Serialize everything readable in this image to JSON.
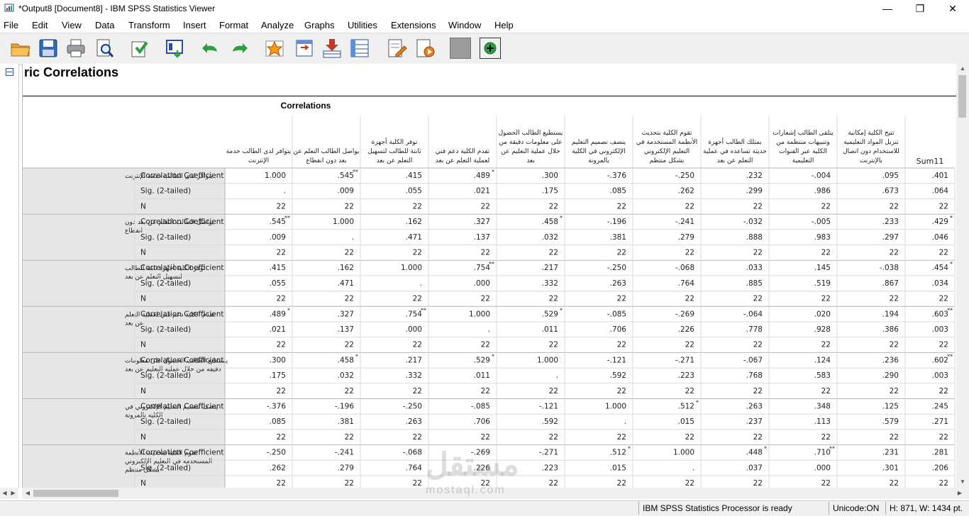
{
  "window": {
    "title": "*Output8 [Document8] - IBM SPSS Statistics Viewer",
    "controls": {
      "minimize": "—",
      "maximize": "❐",
      "close": "✕"
    }
  },
  "menu": [
    "File",
    "Edit",
    "View",
    "Data",
    "Transform",
    "Insert",
    "Format",
    "Analyze",
    "Graphs",
    "Utilities",
    "Extensions",
    "Window",
    "Help"
  ],
  "toolbar": [
    "open-icon",
    "save-icon",
    "print-icon",
    "print-preview-icon",
    "export-icon",
    "recall-dialog-icon",
    "undo-icon",
    "redo-icon",
    "goto-case-icon",
    "goto-variable-icon",
    "insert-cases-icon",
    "variables-icon",
    "designate-window-icon",
    "run-script-icon",
    "select-output-icon",
    "create-edit-icon"
  ],
  "output": {
    "heading": "ric Correlations",
    "table_title": "Correlations",
    "columns": [
      "يتوافر لدى الطالب خدمة الإنترنت",
      "يواصل الطالب التعلم عن بعد دون انقطاع",
      "توفر الكلية أجهزة ثابتة للطالب لتسهيل التعلم عن بعد",
      "تقدم الكلية دعم فني لعملية التعلم عن بعد",
      "يستطيع الطالب الحصول على معلومات دقيقة من خلال عملية التعليم عن بعد",
      "يتصف تصميم التعليم الإلكتروني في الكلية بالمرونة",
      "تقوم الكلية بتحديث الأنظمة المستخدمة في التعليم الإلكتروني بشكل منتظم",
      "يمتلك الطالب أجهزة حديثة تساعده في عملية التعلم عن بعد",
      "يتلقى الطالب إشعارات وتنبيهات منتظمة من الكلية عبر القنوات التعليمية",
      "تتيح الكلية إمكانية تنزيل المواد التعليمية للاستخدام دون اتصال بالإنترنت",
      "Sum11"
    ],
    "stat_labels": [
      "Correlation Coefficient",
      "Sig. (2-tailed)",
      "N"
    ],
    "rows": [
      {
        "label": "يتوافر لدى الطالب خدمة الإنترنت",
        "corr": [
          "1.000",
          ".545**",
          ".415",
          ".489*",
          ".300",
          "-.376",
          "-.250",
          ".232",
          "-.004",
          ".095",
          ".401"
        ],
        "sig": [
          ".",
          ".009",
          ".055",
          ".021",
          ".175",
          ".085",
          ".262",
          ".299",
          ".986",
          ".673",
          ".064"
        ],
        "n": [
          "22",
          "22",
          "22",
          "22",
          "22",
          "22",
          "22",
          "22",
          "22",
          "22",
          "22"
        ]
      },
      {
        "label": "يواصل الطالب التعلم عن بعد دون انقطاع",
        "corr": [
          ".545**",
          "1.000",
          ".162",
          ".327",
          ".458*",
          "-.196",
          "-.241",
          "-.032",
          "-.005",
          ".233",
          ".429*"
        ],
        "sig": [
          ".009",
          ".",
          ".471",
          ".137",
          ".032",
          ".381",
          ".279",
          ".888",
          ".983",
          ".297",
          ".046"
        ],
        "n": [
          "22",
          "22",
          "22",
          "22",
          "22",
          "22",
          "22",
          "22",
          "22",
          "22",
          "22"
        ]
      },
      {
        "label": "توفر الكلية أجهزة ثابتة للطالب لتسهيل التعلم عن بعد",
        "corr": [
          ".415",
          ".162",
          "1.000",
          ".754**",
          ".217",
          "-.250",
          "-.068",
          ".033",
          ".145",
          "-.038",
          ".454*"
        ],
        "sig": [
          ".055",
          ".471",
          ".",
          ".000",
          ".332",
          ".263",
          ".764",
          ".885",
          ".519",
          ".867",
          ".034"
        ],
        "n": [
          "22",
          "22",
          "22",
          "22",
          "22",
          "22",
          "22",
          "22",
          "22",
          "22",
          "22"
        ]
      },
      {
        "label": "تقدم الكلية دعم فني لعملية التعلم عن بعد",
        "corr": [
          ".489*",
          ".327",
          ".754**",
          "1.000",
          ".529*",
          "-.085",
          "-.269",
          "-.064",
          ".020",
          ".194",
          ".603**"
        ],
        "sig": [
          ".021",
          ".137",
          ".000",
          ".",
          ".011",
          ".706",
          ".226",
          ".778",
          ".928",
          ".386",
          ".003"
        ],
        "n": [
          "22",
          "22",
          "22",
          "22",
          "22",
          "22",
          "22",
          "22",
          "22",
          "22",
          "22"
        ]
      },
      {
        "label": "يستطيع الطالب الحصول على معلومات دقيقة من خلال عملية التعليم عن بعد",
        "corr": [
          ".300",
          ".458*",
          ".217",
          ".529*",
          "1.000",
          "-.121",
          "-.271",
          "-.067",
          ".124",
          ".236",
          ".602**"
        ],
        "sig": [
          ".175",
          ".032",
          ".332",
          ".011",
          ".",
          ".592",
          ".223",
          ".768",
          ".583",
          ".290",
          ".003"
        ],
        "n": [
          "22",
          "22",
          "22",
          "22",
          "22",
          "22",
          "22",
          "22",
          "22",
          "22",
          "22"
        ]
      },
      {
        "label": "يتصف تصميم التعليم الإلكتروني في الكلية بالمرونة",
        "corr": [
          "-.376",
          "-.196",
          "-.250",
          "-.085",
          "-.121",
          "1.000",
          ".512*",
          ".263",
          ".348",
          ".125",
          ".245"
        ],
        "sig": [
          ".085",
          ".381",
          ".263",
          ".706",
          ".592",
          ".",
          ".015",
          ".237",
          ".113",
          ".579",
          ".271"
        ],
        "n": [
          "22",
          "22",
          "22",
          "22",
          "22",
          "22",
          "22",
          "22",
          "22",
          "22",
          "22"
        ]
      },
      {
        "label": "تقوم الكلية بتحديث الأنظمة المستخدمة في التعليم الإلكتروني بشكل منتظم",
        "corr": [
          "-.250",
          "-.241",
          "-.068",
          "-.269",
          "-.271",
          ".512*",
          "1.000",
          ".448*",
          ".710**",
          ".231",
          ".281"
        ],
        "sig": [
          ".262",
          ".279",
          ".764",
          ".226",
          ".223",
          ".015",
          ".",
          ".037",
          ".000",
          ".301",
          ".206"
        ],
        "n": [
          "22",
          "22",
          "22",
          "22",
          "22",
          "22",
          "22",
          "22",
          "22",
          "22",
          "22"
        ]
      }
    ]
  },
  "status": {
    "processor": "IBM SPSS Statistics Processor is ready",
    "unicode": "Unicode:ON",
    "size": "H: 871, W: 1434 pt."
  },
  "watermark": {
    "main": "مستقل",
    "sub": "mostaql.com"
  },
  "colors": {
    "label_bg": "#e6e6e6",
    "grid_line": "#dadada",
    "border": "#b4b4b4",
    "accent": "#2a4e9c"
  }
}
